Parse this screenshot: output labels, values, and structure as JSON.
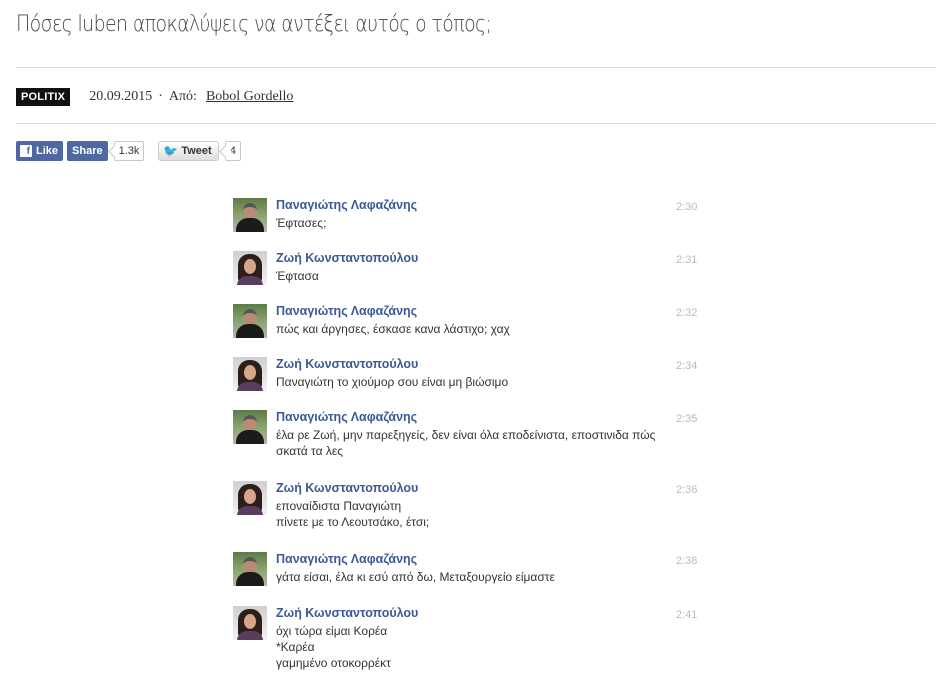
{
  "article": {
    "title": "Πόσες luben αποκαλύψεις να αντέξει αυτός ο τόπος;",
    "category": "POLITIX",
    "date": "20.09.2015",
    "separator": "·",
    "by_label": "Από:",
    "author": "Bobol Gordello"
  },
  "social": {
    "like_label": "Like",
    "share_label": "Share",
    "fb_count": "1.3k",
    "tweet_label": "Tweet",
    "tweet_count": "4",
    "icons": [
      "facebook-icon",
      "twitter-bird-icon"
    ],
    "colors": {
      "facebook": "#4e69a2",
      "twitter": "#2ba3e0"
    }
  },
  "chat": {
    "name_color": "#3b5998",
    "messages": [
      {
        "sender": "Παναγιώτης Λαφαζάνης",
        "avatar": "male",
        "time": "2:30",
        "lines": [
          "Έφτασες;"
        ]
      },
      {
        "sender": "Ζωή Κωνσταντοπούλου",
        "avatar": "female",
        "time": "2:31",
        "lines": [
          "Έφτασα"
        ]
      },
      {
        "sender": "Παναγιώτης Λαφαζάνης",
        "avatar": "male",
        "time": "2:32",
        "lines": [
          "πώς και άργησες, έσκασε κανα λάστιχο; χαχ"
        ]
      },
      {
        "sender": "Ζωή Κωνσταντοπούλου",
        "avatar": "female",
        "time": "2:34",
        "lines": [
          "Παναγιώτη το χιούμορ σου είναι μη βιώσιμο"
        ]
      },
      {
        "sender": "Παναγιώτης Λαφαζάνης",
        "avatar": "male",
        "time": "2:35",
        "lines": [
          "έλα ρε Ζωή, μην παρεξηγείς, δεν είναι όλα εποδείνιστα, εποστινιδα πώς σκατά τα λες"
        ]
      },
      {
        "sender": "Ζωή Κωνσταντοπούλου",
        "avatar": "female",
        "time": "2:36",
        "lines": [
          "εποναίδιστα Παναγιώτη",
          "πίνετε με το Λεουτσάκο, έτσι;"
        ]
      },
      {
        "sender": "Παναγιώτης Λαφαζάνης",
        "avatar": "male",
        "time": "2:38",
        "lines": [
          "γάτα είσαι, έλα κι εσύ από δω, Μεταξουργείο είμαστε"
        ]
      },
      {
        "sender": "Ζωή Κωνσταντοπούλου",
        "avatar": "female",
        "time": "2:41",
        "lines": [
          "όχι τώρα είμαι Κορέα",
          "*Καρέα",
          "γαμημένο οτοκορρέκτ"
        ]
      }
    ]
  }
}
